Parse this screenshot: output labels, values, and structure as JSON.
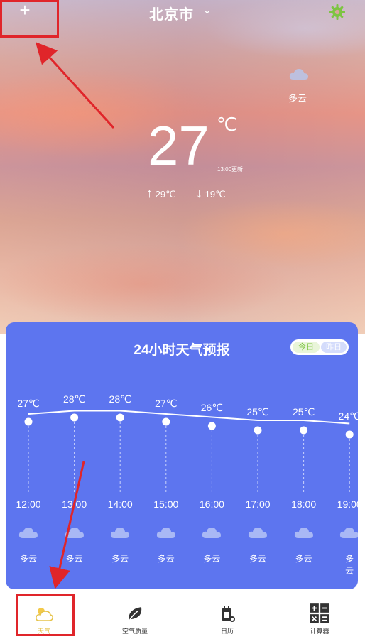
{
  "header": {
    "add_label": "+",
    "city": "北京市",
    "chevron": "⌄",
    "settings_icon": "gear-icon"
  },
  "current": {
    "condition": "多云",
    "temperature": "27",
    "unit": "℃",
    "updated": "13:00更新",
    "high": "29℃",
    "low": "19℃",
    "high_arrow": "↑",
    "low_arrow": "↓"
  },
  "forecast": {
    "title": "24小时天气预报",
    "toggle_today": "今日",
    "toggle_yesterday": "昨日",
    "hours": [
      {
        "time": "12:00",
        "temp": "27℃",
        "cond": "多云"
      },
      {
        "time": "13:00",
        "temp": "28℃",
        "cond": "多云"
      },
      {
        "time": "14:00",
        "temp": "28℃",
        "cond": "多云"
      },
      {
        "time": "15:00",
        "temp": "27℃",
        "cond": "多云"
      },
      {
        "time": "16:00",
        "temp": "26℃",
        "cond": "多云"
      },
      {
        "time": "17:00",
        "temp": "25℃",
        "cond": "多云"
      },
      {
        "time": "18:00",
        "temp": "25℃",
        "cond": "多云"
      },
      {
        "time": "19:00",
        "temp": "24℃",
        "cond": "多云"
      }
    ]
  },
  "nav": {
    "items": [
      {
        "label": "天气",
        "icon": "weather-icon"
      },
      {
        "label": "空气质量",
        "icon": "leaf-icon"
      },
      {
        "label": "日历",
        "icon": "calendar-icon"
      },
      {
        "label": "计算器",
        "icon": "calculator-icon"
      }
    ]
  },
  "colors": {
    "card": "#5d75ef",
    "highlight": "#e0252a",
    "gear": "#7cc441",
    "nav_active": "#e6c34a"
  }
}
